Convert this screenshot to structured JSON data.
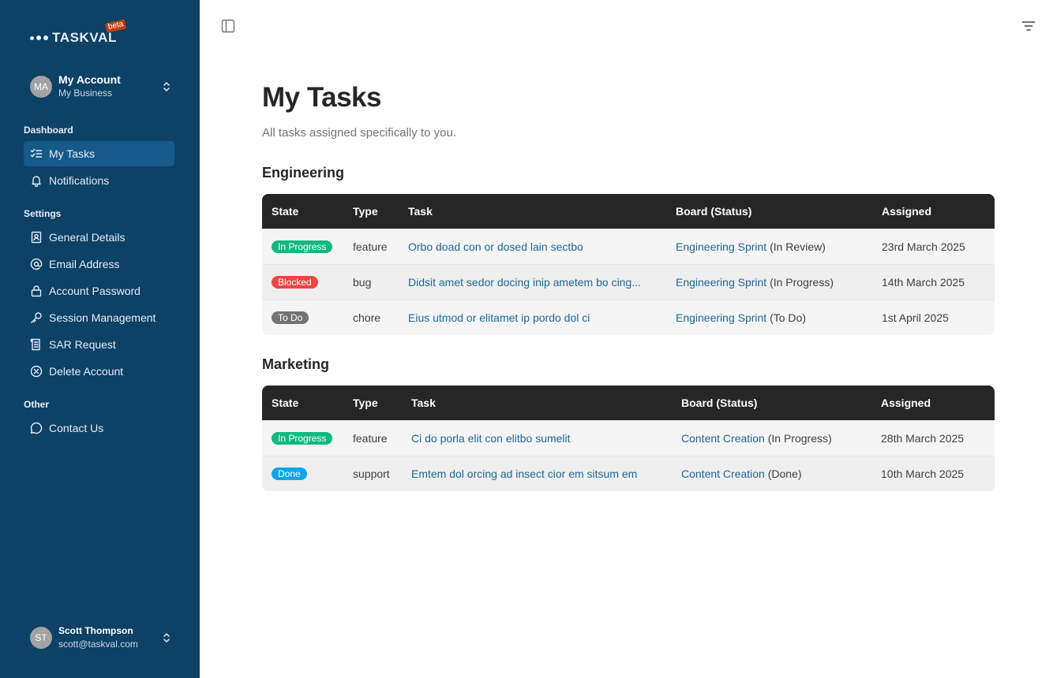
{
  "brand": {
    "name": "TASKVAL",
    "badge": "beta"
  },
  "account": {
    "initials": "MA",
    "name": "My Account",
    "business": "My Business"
  },
  "sidebar": {
    "sections": [
      {
        "label": "Dashboard",
        "items": [
          {
            "label": "My Tasks",
            "icon": "checklist-icon",
            "active": true
          },
          {
            "label": "Notifications",
            "icon": "bell-icon"
          }
        ]
      },
      {
        "label": "Settings",
        "items": [
          {
            "label": "General Details",
            "icon": "contact-card-icon"
          },
          {
            "label": "Email Address",
            "icon": "at-sign-icon"
          },
          {
            "label": "Account Password",
            "icon": "lock-icon"
          },
          {
            "label": "Session Management",
            "icon": "key-icon"
          },
          {
            "label": "SAR Request",
            "icon": "document-list-icon"
          },
          {
            "label": "Delete Account",
            "icon": "circle-x-icon"
          }
        ]
      },
      {
        "label": "Other",
        "items": [
          {
            "label": "Contact Us",
            "icon": "chat-bubble-icon"
          }
        ]
      }
    ]
  },
  "user": {
    "initials": "ST",
    "name": "Scott Thompson",
    "email": "scott@taskval.com"
  },
  "page": {
    "title": "My Tasks",
    "subtitle": "All tasks assigned specifically to you."
  },
  "columns": {
    "state": "State",
    "type": "Type",
    "task": "Task",
    "board": "Board (Status)",
    "assigned": "Assigned"
  },
  "groups": [
    {
      "title": "Engineering",
      "rows": [
        {
          "state": "In Progress",
          "state_color": "#10b981",
          "type": "feature",
          "task": "Orbo doad con or dosed lain sectbo",
          "board": "Engineering Sprint",
          "status": "(In Review)",
          "assigned": "23rd March 2025"
        },
        {
          "state": "Blocked",
          "state_color": "#ef4444",
          "type": "bug",
          "task": "Didsit amet sedor docing inip ametem bo cing...",
          "board": "Engineering Sprint",
          "status": "(In Progress)",
          "assigned": "14th March 2025"
        },
        {
          "state": "To Do",
          "state_color": "#737373",
          "type": "chore",
          "task": "Eius utmod or elitamet ip pordo dol ci",
          "board": "Engineering Sprint",
          "status": "(To Do)",
          "assigned": "1st April 2025"
        }
      ]
    },
    {
      "title": "Marketing",
      "rows": [
        {
          "state": "In Progress",
          "state_color": "#10b981",
          "type": "feature",
          "task": "Ci do porla elit con elitbo sumelit",
          "board": "Content Creation",
          "status": "(In Progress)",
          "assigned": "28th March 2025"
        },
        {
          "state": "Done",
          "state_color": "#0ea5e9",
          "type": "support",
          "task": "Emtem dol orcing ad insect cior em sitsum em",
          "board": "Content Creation",
          "status": "(Done)",
          "assigned": "10th March 2025"
        }
      ]
    }
  ],
  "colors": {
    "sidebar_bg": "#0d4166",
    "active_item": "#155a89",
    "link": "#1d6796",
    "table_header": "#262626"
  }
}
